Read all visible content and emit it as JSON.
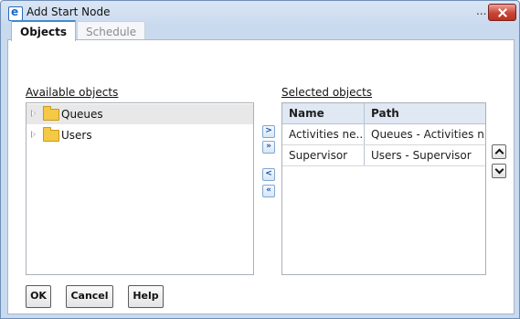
{
  "window": {
    "title": "Add Start Node",
    "title_extra": "..."
  },
  "tabs": [
    {
      "label": "Objects"
    },
    {
      "label": "Schedule"
    }
  ],
  "available": {
    "label": "Available objects",
    "items": [
      {
        "label": "Queues"
      },
      {
        "label": "Users"
      }
    ]
  },
  "selected": {
    "label": "Selected objects",
    "columns": [
      "Name",
      "Path"
    ],
    "rows": [
      {
        "name": "Activities ne...",
        "path": "Queues - Activities n..."
      },
      {
        "name": "Supervisor",
        "path": "Users - Supervisor"
      }
    ]
  },
  "move_buttons": {
    "add": ">",
    "add_all": "»",
    "remove": "<",
    "remove_all": "«"
  },
  "buttons": {
    "ok": "OK",
    "cancel": "Cancel",
    "help": "Help"
  },
  "icons": {
    "app": "ie-app-icon",
    "close": "close-icon",
    "folder": "folder-icon",
    "expander": "expand-triangle-icon",
    "move_up": "chevron-up-icon",
    "move_down": "chevron-down-icon"
  }
}
